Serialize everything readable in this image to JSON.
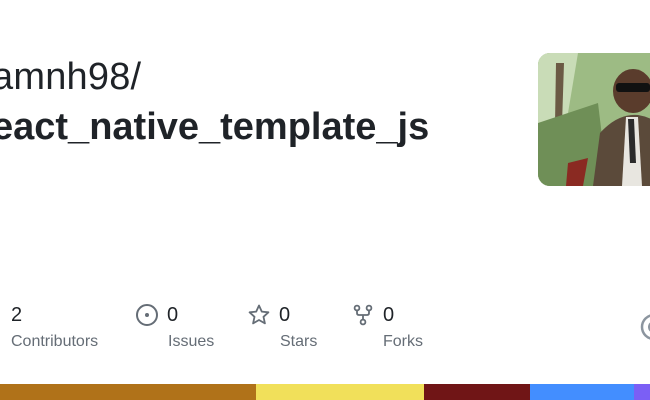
{
  "repo": {
    "owner": "amnh98/",
    "name": "eact_native_template_js"
  },
  "stats": [
    {
      "key": "contributors",
      "value": "2",
      "label": "Contributors",
      "icon": "people-icon"
    },
    {
      "key": "issues",
      "value": "0",
      "label": "Issues",
      "icon": "issue-opened-icon"
    },
    {
      "key": "stars",
      "value": "0",
      "label": "Stars",
      "icon": "star-icon"
    },
    {
      "key": "forks",
      "value": "0",
      "label": "Forks",
      "icon": "repo-forked-icon"
    }
  ],
  "language_bar": {
    "segments": [
      {
        "color": "#b07219",
        "share": 0.394
      },
      {
        "color": "#f1e05a",
        "share": 0.258
      },
      {
        "color": "#701516",
        "share": 0.163
      },
      {
        "color": "#438eff",
        "share": 0.16
      },
      {
        "color": "#7b5ff5",
        "share": 0.025
      }
    ]
  },
  "colors": {
    "text": "#1f2328",
    "muted": "#656d76"
  }
}
